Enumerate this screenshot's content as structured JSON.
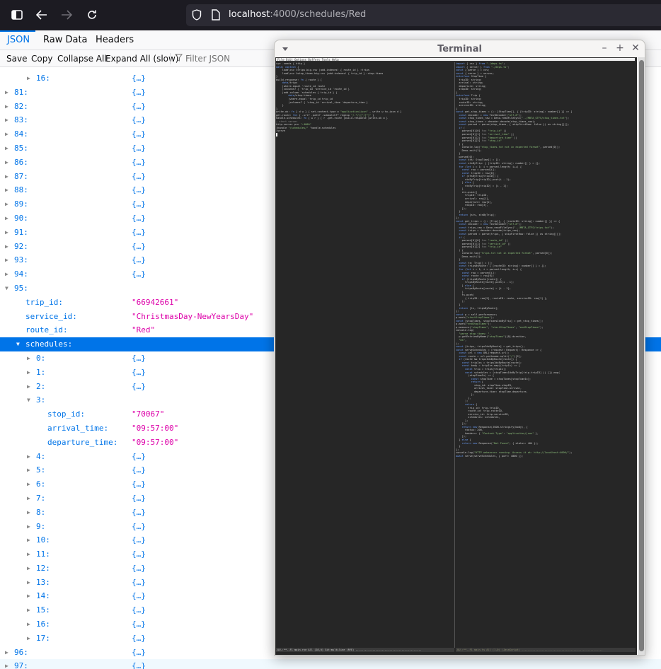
{
  "browser": {
    "url_host": "localhost",
    "url_path": ":4000/schedules/Red",
    "icons": [
      "sidebar-toggle-icon",
      "back-arrow-icon",
      "forward-arrow-icon",
      "reload-icon",
      "shield-icon",
      "page-icon"
    ]
  },
  "viewer": {
    "tabs": [
      {
        "label": "JSON",
        "active": true
      },
      {
        "label": "Raw Data",
        "active": false
      },
      {
        "label": "Headers",
        "active": false
      }
    ],
    "toolbar": {
      "save": "Save",
      "copy": "Copy",
      "collapse_all": "Collapse All",
      "expand_all": "Expand All (slow)",
      "filter_placeholder": "Filter JSON"
    }
  },
  "tree": [
    {
      "depth": 2,
      "key": "16:",
      "value": "{…}",
      "type": "obj",
      "expanded": false
    },
    {
      "depth": 0,
      "key": "81:",
      "value": "{…}",
      "type": "obj",
      "expanded": false
    },
    {
      "depth": 0,
      "key": "82:",
      "value": "{…}",
      "type": "obj",
      "expanded": false
    },
    {
      "depth": 0,
      "key": "83:",
      "value": "{…}",
      "type": "obj",
      "expanded": false
    },
    {
      "depth": 0,
      "key": "84:",
      "value": "{…}",
      "type": "obj",
      "expanded": false
    },
    {
      "depth": 0,
      "key": "85:",
      "value": "{…}",
      "type": "obj",
      "expanded": false
    },
    {
      "depth": 0,
      "key": "86:",
      "value": "{…}",
      "type": "obj",
      "expanded": false
    },
    {
      "depth": 0,
      "key": "87:",
      "value": "{…}",
      "type": "obj",
      "expanded": false
    },
    {
      "depth": 0,
      "key": "88:",
      "value": "{…}",
      "type": "obj",
      "expanded": false
    },
    {
      "depth": 0,
      "key": "89:",
      "value": "{…}",
      "type": "obj",
      "expanded": false
    },
    {
      "depth": 0,
      "key": "90:",
      "value": "{…}",
      "type": "obj",
      "expanded": false
    },
    {
      "depth": 0,
      "key": "91:",
      "value": "{…}",
      "type": "obj",
      "expanded": false
    },
    {
      "depth": 0,
      "key": "92:",
      "value": "{…}",
      "type": "obj",
      "expanded": false
    },
    {
      "depth": 0,
      "key": "93:",
      "value": "{…}",
      "type": "obj",
      "expanded": false
    },
    {
      "depth": 0,
      "key": "94:",
      "value": "{…}",
      "type": "obj",
      "expanded": false
    },
    {
      "depth": 0,
      "key": "95:",
      "value": "",
      "type": "obj",
      "expanded": true
    },
    {
      "depth": 1,
      "key": "trip_id:",
      "value": "\"66942661\"",
      "type": "str",
      "leaf": true
    },
    {
      "depth": 1,
      "key": "service_id:",
      "value": "\"ChristmasDay-NewYearsDay\"",
      "type": "str",
      "leaf": true
    },
    {
      "depth": 1,
      "key": "route_id:",
      "value": "\"Red\"",
      "type": "str",
      "leaf": true
    },
    {
      "depth": 1,
      "key": "schedules:",
      "value": "",
      "type": "obj",
      "expanded": true,
      "selected": true
    },
    {
      "depth": 2,
      "key": "0:",
      "value": "{…}",
      "type": "obj",
      "expanded": false
    },
    {
      "depth": 2,
      "key": "1:",
      "value": "{…}",
      "type": "obj",
      "expanded": false
    },
    {
      "depth": 2,
      "key": "2:",
      "value": "{…}",
      "type": "obj",
      "expanded": false
    },
    {
      "depth": 2,
      "key": "3:",
      "value": "",
      "type": "obj",
      "expanded": true
    },
    {
      "depth": 3,
      "key": "stop_id:",
      "value": "\"70067\"",
      "type": "str",
      "leaf": true
    },
    {
      "depth": 3,
      "key": "arrival_time:",
      "value": "\"09:57:00\"",
      "type": "str",
      "leaf": true
    },
    {
      "depth": 3,
      "key": "departure_time:",
      "value": "\"09:57:00\"",
      "type": "str",
      "leaf": true
    },
    {
      "depth": 2,
      "key": "4:",
      "value": "{…}",
      "type": "obj",
      "expanded": false
    },
    {
      "depth": 2,
      "key": "5:",
      "value": "{…}",
      "type": "obj",
      "expanded": false
    },
    {
      "depth": 2,
      "key": "6:",
      "value": "{…}",
      "type": "obj",
      "expanded": false
    },
    {
      "depth": 2,
      "key": "7:",
      "value": "{…}",
      "type": "obj",
      "expanded": false
    },
    {
      "depth": 2,
      "key": "8:",
      "value": "{…}",
      "type": "obj",
      "expanded": false
    },
    {
      "depth": 2,
      "key": "9:",
      "value": "{…}",
      "type": "obj",
      "expanded": false
    },
    {
      "depth": 2,
      "key": "10:",
      "value": "{…}",
      "type": "obj",
      "expanded": false
    },
    {
      "depth": 2,
      "key": "11:",
      "value": "{…}",
      "type": "obj",
      "expanded": false
    },
    {
      "depth": 2,
      "key": "12:",
      "value": "{…}",
      "type": "obj",
      "expanded": false
    },
    {
      "depth": 2,
      "key": "13:",
      "value": "{…}",
      "type": "obj",
      "expanded": false
    },
    {
      "depth": 2,
      "key": "14:",
      "value": "{…}",
      "type": "obj",
      "expanded": false
    },
    {
      "depth": 2,
      "key": "15:",
      "value": "{…}",
      "type": "obj",
      "expanded": false
    },
    {
      "depth": 2,
      "key": "16:",
      "value": "{…}",
      "type": "obj",
      "expanded": false
    },
    {
      "depth": 2,
      "key": "17:",
      "value": "{…}",
      "type": "obj",
      "expanded": false
    },
    {
      "depth": 0,
      "key": "96:",
      "value": "{…}",
      "type": "obj",
      "expanded": false
    },
    {
      "depth": 0,
      "key": "97:",
      "value": "{…}",
      "type": "obj",
      "expanded": false,
      "hover": true
    }
  ],
  "terminal": {
    "title": "Terminal",
    "menubar": "File Edit Options Buffers Tools Help",
    "left_code": [
      "rye .needs { http }",
      "",
      "data: context {",
      "    load\\csv %trips.big.csv |add-indexes! { route_id } :trips",
      "    load\\csv %stop_times.big.csv |add-indexes! { trip_id } :stop-times",
      "}",
      "",
      "build-response: fn { route } {",
      "    data/trips",
      "    |where-equal 'route_id route",
      "    |columns? { 'trip_id 'service_id 'route_id }",
      "    |add-column 'schedules { trip_id } {",
      "        data/stop-times",
      "        |where-equal 'trip_id trip_id",
      "        |columns? { 'stop_id 'arrival_time 'departure_time }",
      "    }",
      "}",
      "",
      "write-ok: fn { d w } { set-content-type w \"application/json\" , write w to-json d }",
      "get-route: fn1 { .url? .path? .submatch?* regexp \"/.*/([^/]*)\" }",
      "",
      "handle-schedules: fn { w r } { r .get-route |build-response |write-ok w }",
      "",
      "; start server",
      "http-server prn \":4000\"",
      "|handle \"/schedules/\" 'handle-schedules",
      "|serve",
      ""
    ],
    "right_code": [
      "import { csv } from \"./deps.ts\";",
      "import { server } from \"./deps.ts\";",
      "",
      "const { parse } = csv;",
      "const { serve } = server;",
      "",
      "interface StopTime {",
      "  tripID: string;",
      "  arrival: string;",
      "  departure: string;",
      "  stopID: string;",
      "}",
      "",
      "interface Trip {",
      "  tripID: string;",
      "  routeID: string;",
      "  serviceID: string;",
      "}",
      "",
      "const get_stop_times = (): [StopTime[], { [tripID: string]: number[] }] => {",
      "  const decoder = new TextDecoder(\"utf-8\");",
      "  const stop_times_raw = Deno.readFileSync(\"../MBTA_GTFS/stop_times.txt\");",
      "  const stop_times = decoder.decode(stop_times_raw);",
      "  const parsed = parse(stop_times, { skipFirstRow: false }) as string[][];",
      "",
      "  if (",
      "    parsed[0][0] !== \"trip_id\" ||",
      "    parsed[0][1] !== \"arrival_time\" ||",
      "    parsed[0][2] !== \"departure_time\" ||",
      "    parsed[0][3] !== \"stop_id\"",
      "  ) {",
      "    console.log(\"stop_times.txt not in expected format\", parsed[0]);",
      "    Deno.exit(1);",
      "  }",
      "  parsed[0];",
      "",
      "  const sts: StopTime[] = [];",
      "  const stsByTrip: { [tripID: string]: number[] } = {};",
      "",
      "  for (let i = 1; i < parsed.length; i++) {",
      "    const row = parsed[i];",
      "    const tripID = row[0];",
      "    if (stsByTrip[tripID]) {",
      "      stsByTrip[tripID].push(i - 1);",
      "    } else {",
      "      stsByTrip[tripID] = [i - 1];",
      "    }",
      "    sts.push({",
      "      tripID: tripID,",
      "      arrival: row[1],",
      "      departure: row[2],",
      "      stopID: row[3],",
      "    });",
      "  }",
      "",
      "  return [sts, stsByTrip];",
      "};",
      "",
      "const get_trips = (): [Trip[], { [routeID: string]: number[] }] => {",
      "  const decoder = new TextDecoder(\"utf-8\");",
      "  const trips_raw = Deno.readFileSync(\"../MBTA_GTFS/trips.txt\");",
      "  const trips = decoder.decode(trips_raw);",
      "  const parsed = parse(trips, { skipFirstRow: false }) as string[][];",
      "",
      "  if (",
      "    parsed[0][0] !== \"route_id\" ||",
      "    parsed[0][1] !== \"service_id\" ||",
      "    parsed[0][2] !== \"trip_id\"",
      "  ) {",
      "    console.log(\"trips.txt not in expected format\", parsed[0]);",
      "    Deno.exit(1);",
      "  }",
      "",
      "  const ts: Trip[] = [];",
      "  const tripsByRoute: { [routeID: string]: number[] } = {};",
      "",
      "  for (let i = 1; i < parsed.length; i++) {",
      "    const row = parsed[i];",
      "    const route = row[0];",
      "    if (tripsByRoute[route]) {",
      "      tripsByRoute[route].push(i - 1);",
      "    } else {",
      "      tripsByRoute[route] = [i - 1];",
      "    }",
      "    ts.push(",
      "      { tripID: row[2], routeID: route, serviceID: row[1] },",
      "    );",
      "  }",
      "",
      "  return [ts, tripsByRoute];",
      "};",
      "",
      "const p = self.performance;",
      "",
      "p.mark(\"startStopTimes\");",
      "const [stopTimes, stopTimesIdxByTrip] = get_stop_times();",
      "p.mark(\"endStopTimes\");",
      "p.measure(\"stopTimes\", \"startStopTimes\", \"endStopTimes\");",
      "console.log(",
      "  \"parse stop times: \",",
      "  p.getEntriesByName(\"stopTimes\")[0].duration,",
      "  \"ms\",",
      ");",
      "",
      "const [trips, tripsIdxByRoute] = get_trips();",
      "",
      "const serveSchedules = (request: Request): Response => {",
      "  const url = new URL(request.url);",
      "  const route = url.pathname.split(\"/\")[2];",
      "",
      "  if (route && tripsIdxByRoute[route]) {",
      "    const tripIxs = tripsIdxByRoute[route];",
      "",
      "    const body = tripIxs.map((tripIx) => {",
      "      const trip = trips[tripIx];",
      "",
      "      const schedules = (stopTimesIdxByTrip[trip.tripID] || []).map(",
      "        (stopTimeIx) => {",
      "          const stopTime = stopTimes[stopTimeIx];",
      "          return {",
      "            stop_id: stopTime.stopID,",
      "            arrival_time: stopTime.arrival,",
      "            departure_time: stopTime.departure,",
      "          };",
      "        },",
      "      );",
      "",
      "      return {",
      "        trip_id: trip.tripID,",
      "        route_id: trip.routeID,",
      "        service_id: trip.serviceID,",
      "        schedules: schedules,",
      "      };",
      "    });",
      "",
      "    return new Response(JSON.stringify(body), {",
      "      status: 200,",
      "      headers: { \"Content-Type\": \"application/json\" },",
      "    });",
      "  } else {",
      "    return new Response(\"Not Found\", { status: 404 });",
      "  }",
      "};",
      "",
      "console.log(\"HTTP webserver running. Access it at: http://localhost:4000/\");",
      "await serve(serveSchedules, { port: 4000 });"
    ],
    "modeline_left": "-UU-:**--F1  main.rye      All (28,0)    Git:multiline   (RYE) -------------------------------------------",
    "modeline_right": "-UU-:**--F1  main.ts       All (1,0)      (JavaScript) -----------------------------------------------------"
  }
}
